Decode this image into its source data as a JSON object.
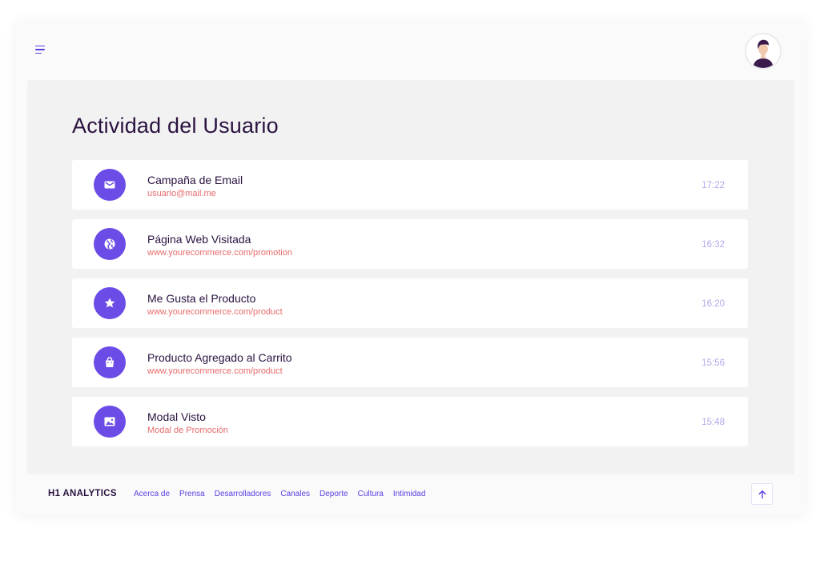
{
  "header": {
    "menu_icon": "menu-icon",
    "avatar_icon": "user-avatar"
  },
  "main": {
    "title": "Actividad del Usuario",
    "activities": [
      {
        "icon": "mail-icon",
        "title": "Campaña de Email",
        "subtitle": "usuario@mail.me",
        "time": "17:22"
      },
      {
        "icon": "globe-icon",
        "title": "Página Web Visitada",
        "subtitle": "www.yourecommerce.com/promotion",
        "time": "16:32"
      },
      {
        "icon": "star-icon",
        "title": "Me Gusta el Producto",
        "subtitle": "www.yourecommerce.com/product",
        "time": "16:20"
      },
      {
        "icon": "shopping-bag-icon",
        "title": "Producto Agregado al Carrito",
        "subtitle": "www.yourecommerce.com/product",
        "time": "15:56"
      },
      {
        "icon": "image-icon",
        "title": "Modal Visto",
        "subtitle": "Modal de Promoción",
        "time": "15:48"
      }
    ]
  },
  "footer": {
    "brand": "H1 ANALYTICS",
    "links": [
      "Acerca de",
      "Prensa",
      "Desarrolladores",
      "Canales",
      "Deporte",
      "Cultura",
      "Intimidad"
    ],
    "to_top_icon": "arrow-up-icon"
  },
  "colors": {
    "accent": "#6c4ce6",
    "link": "#5b3fe4",
    "subtitle": "#e66b6b",
    "time": "#b3a8ea",
    "text": "#2a1240"
  }
}
